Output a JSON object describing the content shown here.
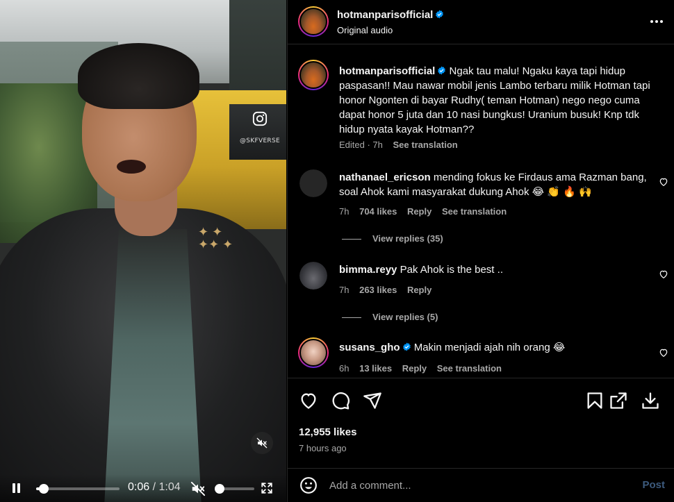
{
  "video": {
    "watermark": "@SKFVERSE",
    "current_time": "0:06",
    "separator": "/",
    "duration": "1:04",
    "progress": 0.094,
    "volume": 0.1
  },
  "header": {
    "username": "hotmanparisofficial",
    "audio": "Original audio"
  },
  "caption": {
    "username": "hotmanparisofficial",
    "text": "Ngak tau malu! Ngaku kaya tapi hidup paspasan!! Mau nawar mobil jenis Lambo terbaru milik Hotman tapi honor Ngonten di bayar Rudhy( teman Hotman) nego nego cuma dapat honor 5 juta dan 10 nasi bungkus! Uranium busuk! Knp tdk hidup nyata kayak Hotman??",
    "edited": "Edited · 7h",
    "see_translation": "See translation"
  },
  "comments": [
    {
      "username": "nathanael_ericson",
      "text": "mending fokus ke Firdaus ama Razman bang, soal Ahok kami masyarakat dukung Ahok 😂 👏 🔥 🙌",
      "time": "7h",
      "likes": "704 likes",
      "reply": "Reply",
      "see_translation": "See translation",
      "view_replies": "View replies (35)"
    },
    {
      "username": "bimma.reyy",
      "text": "Pak Ahok is the best ..",
      "time": "7h",
      "likes": "263 likes",
      "reply": "Reply",
      "view_replies": "View replies (5)"
    },
    {
      "username": "susans_gho",
      "text": "Makin menjadi ajah nih orang 😂",
      "time": "6h",
      "likes": "13 likes",
      "reply": "Reply",
      "see_translation": "See translation"
    }
  ],
  "post": {
    "likes": "12,955 likes",
    "ago": "7 hours ago"
  },
  "add_comment": {
    "placeholder": "Add a comment...",
    "post_label": "Post"
  },
  "colors": {
    "background": "#000000",
    "text": "#f5f5f5",
    "secondary_text": "#a8a8a8",
    "verified_badge": "#0095f6",
    "post_button_disabled": "#3d5b7e",
    "divider": "#262626"
  },
  "icons": [
    "instagram-icon",
    "mute-icon",
    "pause-icon",
    "volume-muted-icon",
    "fullscreen-icon",
    "verified-icon",
    "more-icon",
    "heart-icon",
    "comment-icon",
    "share-icon",
    "bookmark-icon",
    "external-link-icon",
    "download-icon",
    "emoji-icon"
  ]
}
